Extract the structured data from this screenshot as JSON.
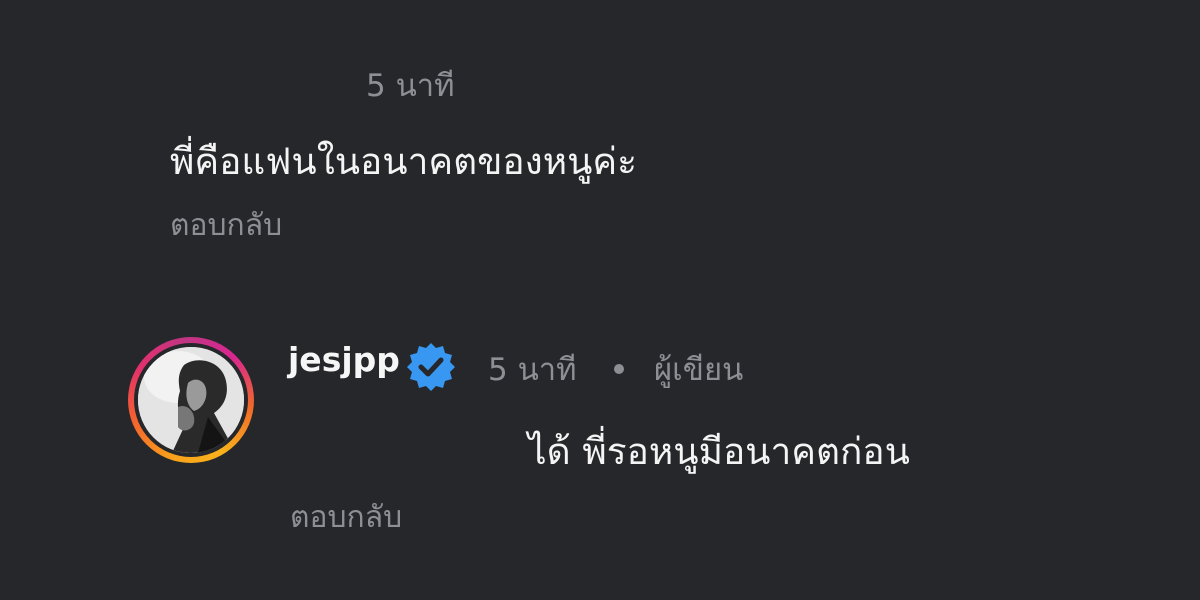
{
  "comment_1": {
    "time": "5 นาที",
    "text": "พี่คือแฟนในอนาคตของหนูค่ะ",
    "reply_label": "ตอบกลับ"
  },
  "comment_2": {
    "username": "jesjpp",
    "verified_icon": "verified-badge-icon",
    "time": "5 นาที",
    "separator": "•",
    "role": "ผู้เขียน",
    "text": "ได้ พี่รอหนูมีอนาคตก่อน",
    "reply_label": "ตอบกลับ",
    "avatar_icon": "profile-photo"
  },
  "colors": {
    "background": "#26272b",
    "primary_text": "#f4f4f4",
    "secondary_text": "#8e8f94",
    "verified_blue": "#3897f0",
    "story_ring_start": "#f9a01b",
    "story_ring_end": "#c13584"
  }
}
